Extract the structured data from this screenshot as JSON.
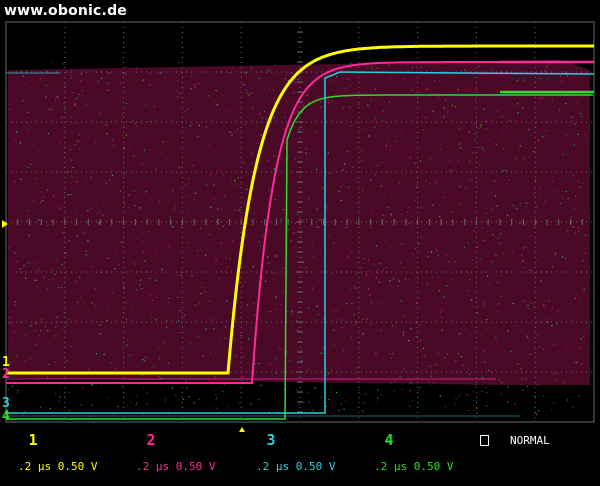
{
  "watermark": "www.obonic.de",
  "trigger_mode": "NORMAL",
  "channels": [
    {
      "id": "1",
      "label": "1",
      "timebase": ".2 µs",
      "volts": "0.50 V",
      "color": "#ffff00"
    },
    {
      "id": "2",
      "label": "2",
      "timebase": ".2 µs",
      "volts": "0.50 V",
      "color": "#ff2a9a"
    },
    {
      "id": "3",
      "label": "3",
      "timebase": ".2 µs",
      "volts": "0.50 V",
      "color": "#2ad0e0"
    },
    {
      "id": "4",
      "label": "4",
      "timebase": ".2 µs",
      "volts": "0.50 V",
      "color": "#28e028"
    }
  ],
  "colors": {
    "grid": "#6a6a6a",
    "persistence": "#5a0a2e",
    "trigger_marker": "#ffff00"
  }
}
